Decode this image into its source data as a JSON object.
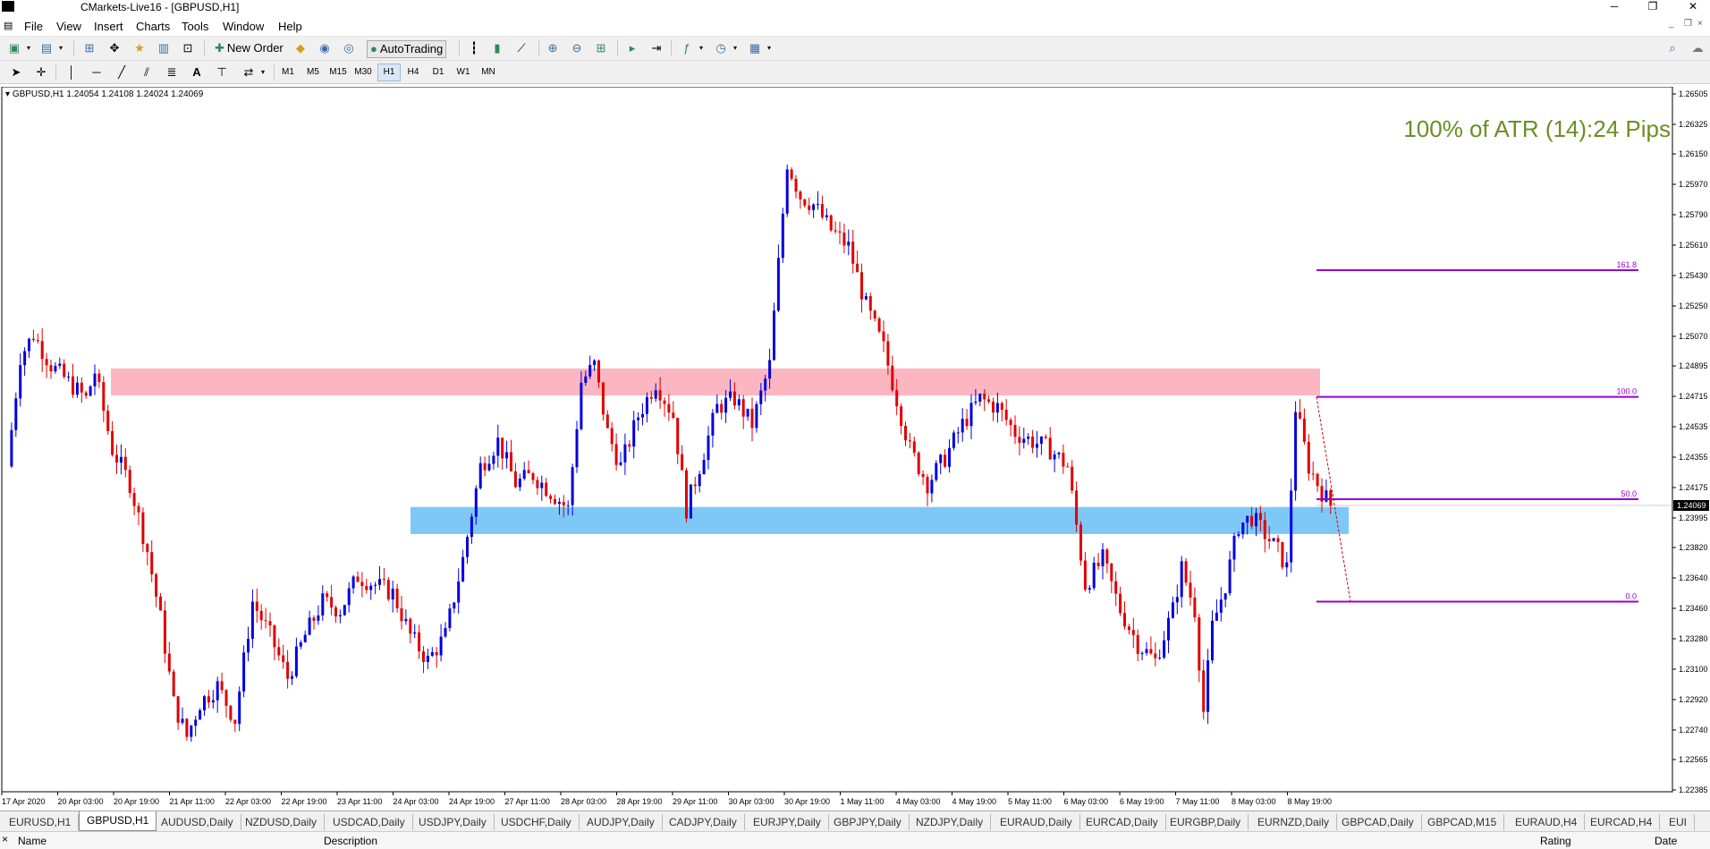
{
  "window": {
    "title": "CMarkets-Live16 - [GBPUSD,H1]",
    "controls": [
      "─",
      "❐",
      "✕"
    ],
    "mdi_controls": [
      "_",
      "❐",
      "×"
    ]
  },
  "menu": [
    "File",
    "View",
    "Insert",
    "Charts",
    "Tools",
    "Window",
    "Help"
  ],
  "toolbar": {
    "new_order": "New Order",
    "autotrading": "AutoTrading"
  },
  "timeframes": [
    "M1",
    "M5",
    "M15",
    "M30",
    "H1",
    "H4",
    "D1",
    "W1",
    "MN"
  ],
  "active_timeframe": "H1",
  "chart": {
    "info": "GBPUSD,H1  1.24054 1.24108 1.24024 1.24069",
    "atr_text": "100% of ATR (14):24 Pips",
    "atr_color": "#6b8e23",
    "current_price_label": "1.24069",
    "colors": {
      "bull": "#0000e0",
      "bear": "#e00000",
      "resistance_zone": "#fbb6c1",
      "support_zone": "#7ec8f7",
      "fib": "#9900cc"
    },
    "resistance_zone": [
      1.2472,
      1.2488
    ],
    "support_zone": [
      1.239,
      1.2406
    ],
    "fib_levels": [
      {
        "label": "161.8",
        "price": 1.25462
      },
      {
        "label": "100.0",
        "price": 1.24712
      },
      {
        "label": "50.0",
        "price": 1.24106
      },
      {
        "label": "0.0",
        "price": 1.235
      }
    ]
  },
  "chart_data": {
    "type": "candlestick",
    "symbol": "GBPUSD",
    "timeframe": "H1",
    "ylim": [
      1.22385,
      1.26505
    ],
    "y_ticks": [
      "1.26505",
      "1.26325",
      "1.26150",
      "1.25970",
      "1.25790",
      "1.25610",
      "1.25430",
      "1.25250",
      "1.25070",
      "1.24895",
      "1.24715",
      "1.24535",
      "1.24355",
      "1.24175",
      "1.23995",
      "1.23820",
      "1.23640",
      "1.23460",
      "1.23280",
      "1.23100",
      "1.22920",
      "1.22740",
      "1.22565",
      "1.22385"
    ],
    "x_ticks": [
      "17 Apr 2020",
      "20 Apr 03:00",
      "20 Apr 19:00",
      "21 Apr 11:00",
      "22 Apr 03:00",
      "22 Apr 19:00",
      "23 Apr 11:00",
      "24 Apr 03:00",
      "24 Apr 19:00",
      "27 Apr 11:00",
      "28 Apr 03:00",
      "28 Apr 19:00",
      "29 Apr 11:00",
      "30 Apr 03:00",
      "30 Apr 19:00",
      "1 May 11:00",
      "4 May 03:00",
      "4 May 19:00",
      "5 May 11:00",
      "6 May 03:00",
      "6 May 19:00",
      "7 May 11:00",
      "8 May 03:00",
      "8 May 19:00"
    ],
    "price_path": [
      [
        0,
        1.243
      ],
      [
        3,
        1.2495
      ],
      [
        6,
        1.2508
      ],
      [
        10,
        1.249
      ],
      [
        14,
        1.248
      ],
      [
        18,
        1.247
      ],
      [
        20,
        1.2486
      ],
      [
        24,
        1.244
      ],
      [
        28,
        1.242
      ],
      [
        32,
        1.238
      ],
      [
        35,
        1.234
      ],
      [
        38,
        1.229
      ],
      [
        41,
        1.227
      ],
      [
        44,
        1.229
      ],
      [
        48,
        1.23
      ],
      [
        52,
        1.228
      ],
      [
        56,
        1.235
      ],
      [
        60,
        1.233
      ],
      [
        64,
        1.2305
      ],
      [
        68,
        1.233
      ],
      [
        72,
        1.235
      ],
      [
        76,
        1.2345
      ],
      [
        80,
        1.2365
      ],
      [
        84,
        1.236
      ],
      [
        88,
        1.2355
      ],
      [
        92,
        1.233
      ],
      [
        96,
        1.2315
      ],
      [
        100,
        1.233
      ],
      [
        104,
        1.2375
      ],
      [
        108,
        1.243
      ],
      [
        112,
        1.2445
      ],
      [
        116,
        1.242
      ],
      [
        120,
        1.2425
      ],
      [
        124,
        1.2415
      ],
      [
        128,
        1.2405
      ],
      [
        131,
        1.248
      ],
      [
        134,
        1.249
      ],
      [
        137,
        1.245
      ],
      [
        140,
        1.243
      ],
      [
        144,
        1.246
      ],
      [
        148,
        1.248
      ],
      [
        152,
        1.246
      ],
      [
        155,
        1.2405
      ],
      [
        158,
        1.243
      ],
      [
        162,
        1.2465
      ],
      [
        166,
        1.247
      ],
      [
        170,
        1.2455
      ],
      [
        174,
        1.249
      ],
      [
        176,
        1.255
      ],
      [
        178,
        1.261
      ],
      [
        181,
        1.259
      ],
      [
        184,
        1.2585
      ],
      [
        188,
        1.257
      ],
      [
        192,
        1.256
      ],
      [
        196,
        1.2525
      ],
      [
        200,
        1.25
      ],
      [
        203,
        1.247
      ],
      [
        206,
        1.244
      ],
      [
        210,
        1.242
      ],
      [
        214,
        1.2435
      ],
      [
        218,
        1.2455
      ],
      [
        222,
        1.247
      ],
      [
        226,
        1.2465
      ],
      [
        230,
        1.245
      ],
      [
        234,
        1.2445
      ],
      [
        238,
        1.244
      ],
      [
        242,
        1.243
      ],
      [
        246,
        1.236
      ],
      [
        250,
        1.2375
      ],
      [
        254,
        1.2345
      ],
      [
        258,
        1.2325
      ],
      [
        262,
        1.2315
      ],
      [
        266,
        1.2345
      ],
      [
        268,
        1.237
      ],
      [
        271,
        1.2345
      ],
      [
        273,
        1.2285
      ],
      [
        275,
        1.2335
      ],
      [
        278,
        1.236
      ],
      [
        281,
        1.2395
      ],
      [
        284,
        1.24
      ],
      [
        287,
        1.239
      ],
      [
        290,
        1.238
      ],
      [
        292,
        1.237
      ],
      [
        294,
        1.2465
      ],
      [
        297,
        1.243
      ],
      [
        300,
        1.2415
      ],
      [
        302,
        1.2407
      ]
    ],
    "bar_count": 302,
    "annotations": [
      "100% of ATR (14):24 Pips"
    ]
  },
  "tabs": [
    "EURUSD,H1",
    "GBPUSD,H1",
    "AUDUSD,Daily",
    "NZDUSD,Daily",
    "USDCAD,Daily",
    "USDJPY,Daily",
    "USDCHF,Daily",
    "AUDJPY,Daily",
    "CADJPY,Daily",
    "EURJPY,Daily",
    "GBPJPY,Daily",
    "NZDJPY,Daily",
    "EURAUD,Daily",
    "EURCAD,Daily",
    "EURGBP,Daily",
    "EURNZD,Daily",
    "GBPCAD,Daily",
    "GBPCAD,M15",
    "EURAUD,H4",
    "EURCAD,H4",
    "EUI"
  ],
  "active_tab": "GBPUSD,H1",
  "terminal": {
    "close": "×",
    "columns": [
      "Name",
      "Description",
      "Rating",
      "Date"
    ]
  }
}
